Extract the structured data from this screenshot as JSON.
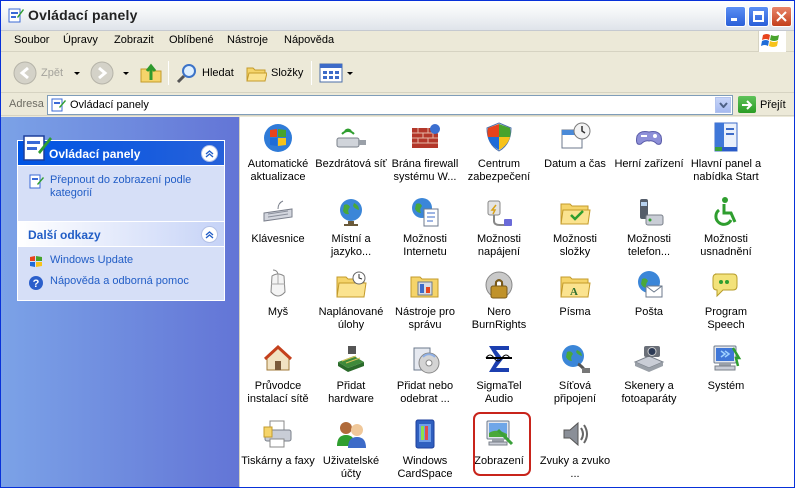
{
  "window": {
    "title": "Ovládací panely"
  },
  "menu": [
    "Soubor",
    "Úpravy",
    "Zobrazit",
    "Oblíbené",
    "Nástroje",
    "Nápověda"
  ],
  "toolbar": {
    "back": "Zpět",
    "search": "Hledat",
    "folders": "Složky"
  },
  "address": {
    "label": "Adresa",
    "value": "Ovládací panely",
    "go": "Přejít"
  },
  "taskpane": {
    "panel1": {
      "title": "Ovládací panely",
      "link": "Přepnout do zobrazení podle kategorií"
    },
    "panel2": {
      "title": "Další odkazy",
      "links": [
        "Windows Update",
        "Nápověda a odborná pomoc"
      ]
    }
  },
  "items": [
    "Automatické aktualizace",
    "Bezdrátová síť",
    "Brána firewall systému W...",
    "Centrum zabezpečení",
    "Datum a čas",
    "Herní zařízení",
    "Hlavní panel a nabídka Start",
    "Klávesnice",
    "Místní a jazyko...",
    "Možnosti Internetu",
    "Možnosti napájení",
    "Možnosti složky",
    "Možnosti telefon...",
    "Možnosti usnadnění",
    "Myš",
    "Naplánované úlohy",
    "Nástroje pro správu",
    "Nero BurnRights",
    "Písma",
    "Pošta",
    "Program Speech",
    "Průvodce instalací sítě",
    "Přidat hardware",
    "Přidat nebo odebrat ...",
    "SigmaTel Audio",
    "Síťová připojení",
    "Skenery a fotoaparáty",
    "Systém",
    "Tiskárny a faxy",
    "Uživatelské účty",
    "Windows CardSpace",
    "Zobrazení",
    "Zvuky a zvuko ..."
  ]
}
